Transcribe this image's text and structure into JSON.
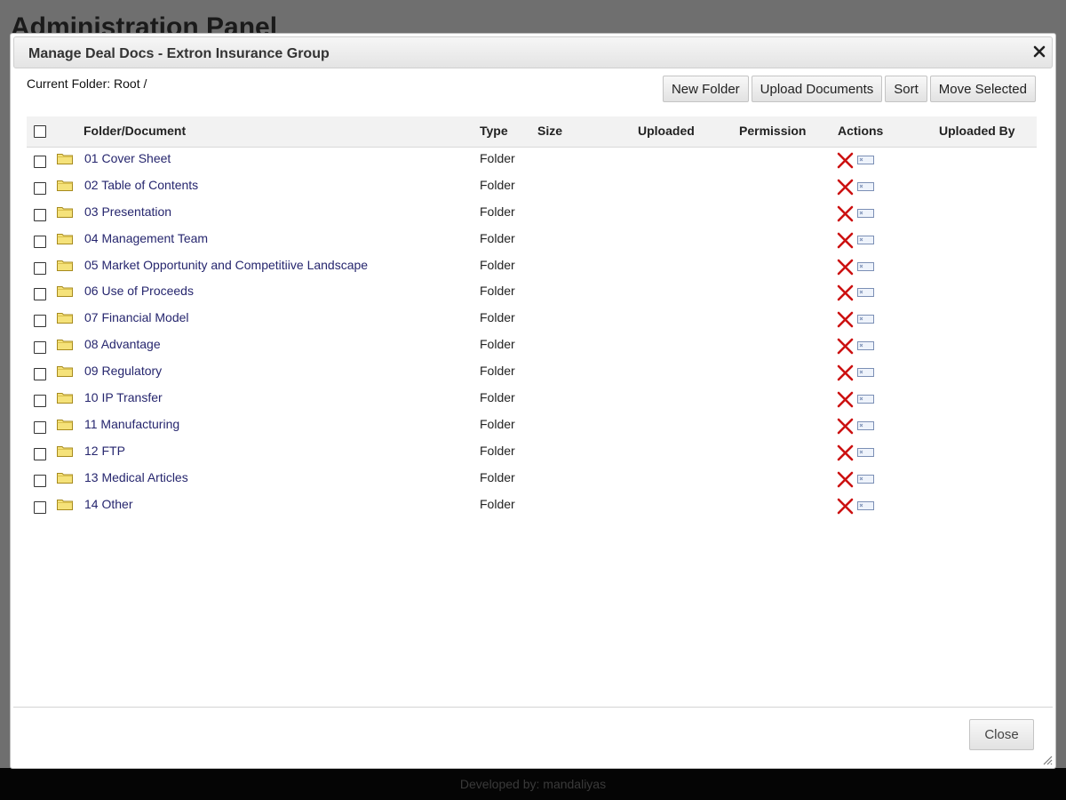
{
  "background": {
    "title": "Administration Panel",
    "footer": "Developed by: mandaliyas"
  },
  "dialog": {
    "title": "Manage Deal Docs - Extron Insurance Group",
    "current_folder": "Current Folder: Root /",
    "toolbar": {
      "new_folder": "New Folder",
      "upload_documents": "Upload Documents",
      "sort": "Sort",
      "move_selected": "Move Selected"
    },
    "columns": {
      "name": "Folder/Document",
      "type": "Type",
      "size": "Size",
      "uploaded": "Uploaded",
      "permission": "Permission",
      "actions": "Actions",
      "uploaded_by": "Uploaded By"
    },
    "rows": [
      {
        "name": "01 Cover Sheet",
        "type": "Folder"
      },
      {
        "name": "02 Table of Contents",
        "type": "Folder"
      },
      {
        "name": "03 Presentation",
        "type": "Folder"
      },
      {
        "name": "04 Management Team",
        "type": "Folder"
      },
      {
        "name": "05 Market Opportunity and Competitiive Landscape",
        "type": "Folder"
      },
      {
        "name": "06 Use of Proceeds",
        "type": "Folder"
      },
      {
        "name": "07 Financial Model",
        "type": "Folder"
      },
      {
        "name": "08 Advantage",
        "type": "Folder"
      },
      {
        "name": "09 Regulatory",
        "type": "Folder"
      },
      {
        "name": "10 IP Transfer",
        "type": "Folder"
      },
      {
        "name": "11 Manufacturing",
        "type": "Folder"
      },
      {
        "name": "12 FTP",
        "type": "Folder"
      },
      {
        "name": "13 Medical Articles",
        "type": "Folder"
      },
      {
        "name": "14 Other",
        "type": "Folder"
      }
    ],
    "close_button": "Close"
  },
  "colors": {
    "link": "#26266e",
    "delete_icon": "#cc1111",
    "folder_icon": "#f5e27a"
  },
  "icons": {
    "close": "close-x-icon",
    "folder": "folder-icon",
    "delete": "red-x-delete-icon",
    "edit": "edit-rename-icon",
    "resize": "resize-grip-icon"
  }
}
